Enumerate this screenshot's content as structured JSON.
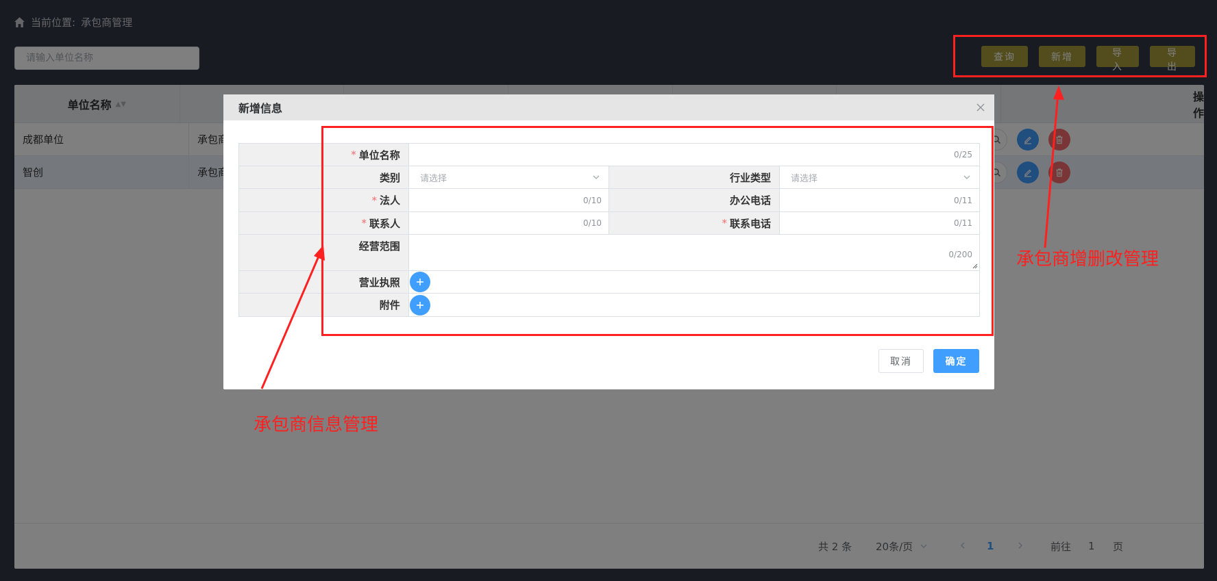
{
  "breadcrumb": {
    "prefix": "当前位置:",
    "current": "承包商管理"
  },
  "search": {
    "placeholder": "请输入单位名称"
  },
  "toolbar": {
    "query": "查询",
    "add": "新增",
    "import": "导入",
    "export": "导出"
  },
  "table": {
    "headers": {
      "unit_name": "单位名称",
      "actions": "操作"
    },
    "rows": [
      {
        "unit_name": "成都单位",
        "col2": "承包商"
      },
      {
        "unit_name": "智创",
        "col2": "承包商"
      }
    ]
  },
  "pagination": {
    "total": "共 2 条",
    "page_size": "20条/页",
    "current": "1",
    "goto_label": "前往",
    "goto_value": "1",
    "page_unit": "页"
  },
  "dialog": {
    "title": "新增信息",
    "fields": {
      "unit_name": {
        "label": "单位名称",
        "counter": "0/25"
      },
      "category": {
        "label": "类别",
        "placeholder": "请选择"
      },
      "industry": {
        "label": "行业类型",
        "placeholder": "请选择"
      },
      "legal": {
        "label": "法人",
        "counter": "0/10"
      },
      "office_phone": {
        "label": "办公电话",
        "counter": "0/11"
      },
      "contact": {
        "label": "联系人",
        "counter": "0/10"
      },
      "contact_phone": {
        "label": "联系电话",
        "counter": "0/11"
      },
      "scope": {
        "label": "经营范围",
        "counter": "0/200"
      },
      "license": {
        "label": "营业执照"
      },
      "attachment": {
        "label": "附件"
      }
    },
    "cancel": "取消",
    "confirm": "确定"
  },
  "annotations": {
    "crud": "承包商增删改管理",
    "info": "承包商信息管理",
    "color": "#ff2020"
  },
  "colors": {
    "toolbar_button": "#a69b3b",
    "primary": "#409eff"
  }
}
